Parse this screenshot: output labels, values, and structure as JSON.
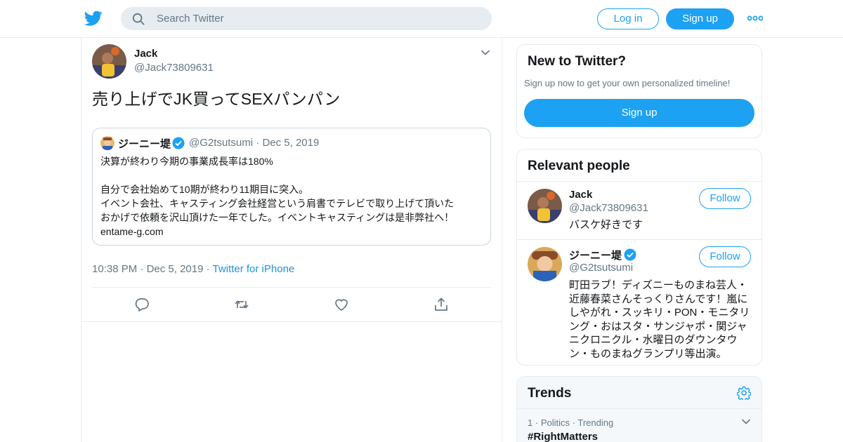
{
  "header": {
    "search_placeholder": "Search Twitter",
    "login_label": "Log in",
    "signup_label": "Sign up",
    "brand_color": "#1da1f2"
  },
  "tweet": {
    "author_name": "Jack",
    "author_handle": "@Jack73809631",
    "text": "売り上げでJK買ってSEXパンパン",
    "time": "10:38 PM",
    "date": "Dec 5, 2019",
    "source": "Twitter for iPhone",
    "separator": "·",
    "quote": {
      "name": "ジーニー堤",
      "handle": "@G2tsutsumi",
      "date": "Dec 5, 2019",
      "body_lines": [
        "決算が終わり今期の事業成長率は180%",
        "",
        "自分で会社始めて10期が終わり11期目に突入。",
        "イベント会社、キャスティング会社経営という肩書でテレビで取り上げて頂いた",
        "おかげで依頼を沢山頂けた一年でした。イベントキャスティングは是非弊社へ！",
        "entame-g.com"
      ]
    },
    "actions": [
      "reply-icon",
      "retweet-icon",
      "like-icon",
      "share-icon"
    ]
  },
  "sidebar": {
    "new_to_twitter": {
      "title": "New to Twitter?",
      "subtitle": "Sign up now to get your own personalized timeline!",
      "button": "Sign up"
    },
    "relevant_people": {
      "title": "Relevant people",
      "people": [
        {
          "name": "Jack",
          "handle": "@Jack73809631",
          "follow_label": "Follow",
          "verified": false,
          "bio_lines": [
            "バスケ好きです"
          ]
        },
        {
          "name": "ジーニー堤",
          "handle": "@G2tsutsumi",
          "follow_label": "Follow",
          "verified": true,
          "bio_lines": [
            "町田ラブ！ディズニーものまね芸人・",
            "近藤春菜さんそっくりさんです！嵐に",
            "しやがれ・スッキリ・PON・モニタリ",
            "ング・おはスタ・サンジャポ・関ジャ",
            "ニクロニクル・水曜日のダウンタウ",
            "ン・ものまねグランプリ等出演。"
          ]
        }
      ]
    },
    "trends": {
      "title": "Trends",
      "items": [
        {
          "rank": "1",
          "category": "Politics",
          "status": "Trending",
          "tag": "#RightMatters"
        }
      ]
    }
  }
}
